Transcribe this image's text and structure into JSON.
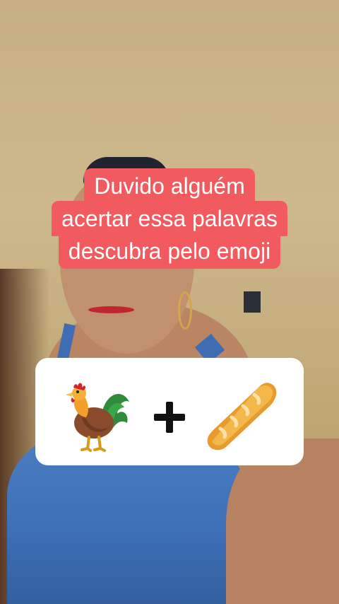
{
  "caption": {
    "line1": "Duvido alguém",
    "line2": "acertar essa palavras",
    "line3": "descubra pelo emoji"
  },
  "emoji_puzzle": {
    "left_emoji": "rooster-icon",
    "operator": "plus-icon",
    "right_emoji": "baguette-icon"
  },
  "colors": {
    "caption_bg": "#f15a5e",
    "caption_text": "#ffffff",
    "card_bg": "#ffffff"
  }
}
